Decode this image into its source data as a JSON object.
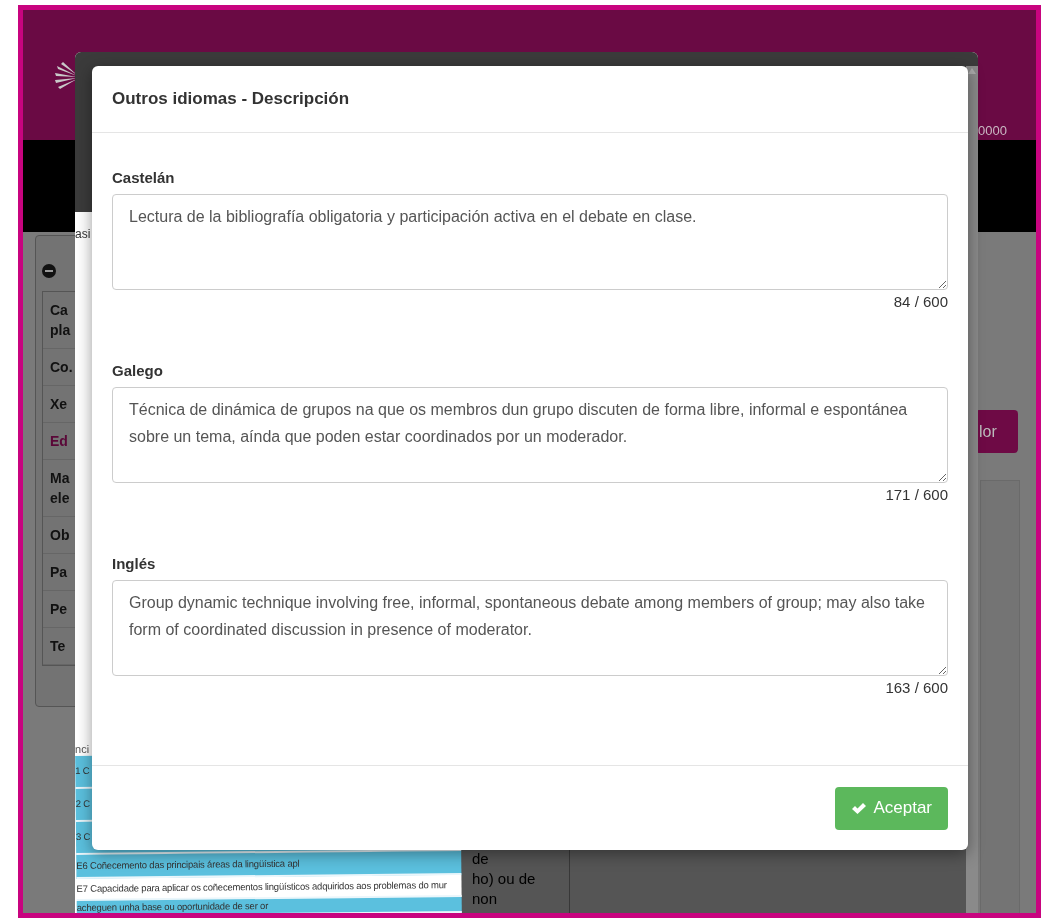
{
  "background": {
    "header_text": "0000",
    "tab_label": "asi",
    "side_rows": [
      {
        "lines": [
          "Ca",
          "pla"
        ],
        "selected": false
      },
      {
        "lines": [
          "Co."
        ],
        "selected": false
      },
      {
        "lines": [
          "Xe"
        ],
        "selected": false
      },
      {
        "lines": [
          "Ed"
        ],
        "selected": true
      },
      {
        "lines": [
          "Ma",
          "ele"
        ],
        "selected": false
      },
      {
        "lines": [
          "Ob"
        ],
        "selected": false
      },
      {
        "lines": [
          "Pa"
        ],
        "selected": false
      },
      {
        "lines": [
          "Pe"
        ],
        "selected": false
      },
      {
        "lines": [
          "Te"
        ],
        "selected": false
      }
    ],
    "side_button": "lor",
    "list_header": "nci",
    "list_rows": [
      {
        "text": "1 C",
        "color": "#5bc0de"
      },
      {
        "text": "2 C",
        "color": "#5bc0de"
      },
      {
        "text": "3 C",
        "color": "#5bc0de"
      },
      {
        "text": "E6 Coñecemento das principais áreas da lingüística apl",
        "color": "#5bc0de"
      },
      {
        "text": "E7 Capacidade para aplicar os coñecementos lingüísticos adquiridos aos problemas do mur",
        "color": "#ffffff"
      },
      {
        "text": "acheguen unha base ou oportunidade de ser or",
        "color": "#5bc0de"
      }
    ],
    "table_lines": [
      "de",
      "ho) ou de",
      "non"
    ]
  },
  "modal": {
    "title": "Outros idiomas - Descripción",
    "fields": [
      {
        "label": "Castelán",
        "value": "Lectura de la bibliografía obligatoria y participación activa en el debate en clase.",
        "counter": "84 / 600"
      },
      {
        "label": "Galego",
        "value": "Técnica de dinámica de grupos na que os membros dun grupo discuten de forma libre, informal e espontánea sobre un tema, aínda que poden estar coordinados por un moderador.",
        "counter": "171 / 600"
      },
      {
        "label": "Inglés",
        "value": "Group dynamic technique involving free, informal, spontaneous debate among members of group; may also take form of coordinated discussion in presence of moderator.",
        "counter": "163 / 600"
      }
    ],
    "accept_button": "Aceptar"
  }
}
